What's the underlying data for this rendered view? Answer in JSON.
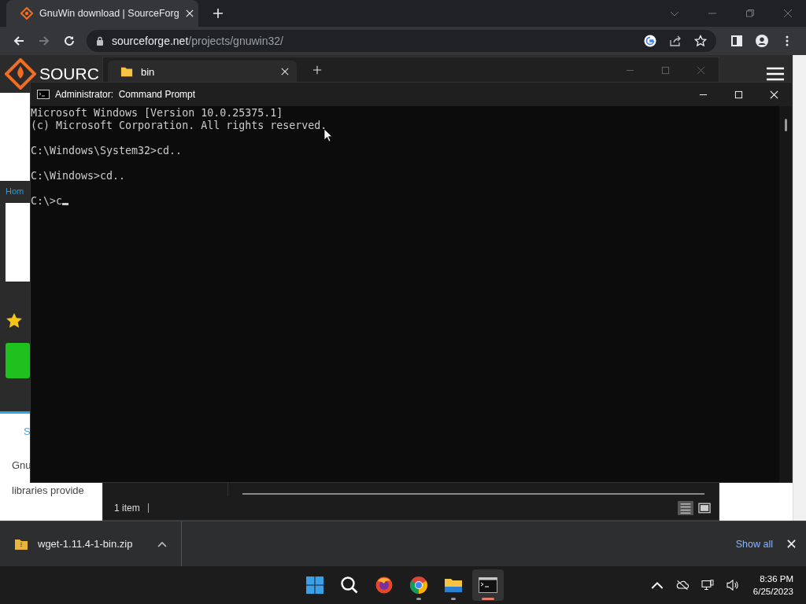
{
  "browser": {
    "tab": {
      "title": "GnuWin download | SourceForg"
    },
    "url": {
      "host": "sourceforge.net",
      "path": "/projects/gnuwin32/"
    }
  },
  "web_page": {
    "logo_text": "SOURC",
    "breadcrumb": "Hom",
    "section_tab": "S",
    "description": [
      "Gnu",
      "libraries provide"
    ]
  },
  "explorer": {
    "tab": "bin",
    "status": "1 item"
  },
  "cmd": {
    "title": "Administrator:  Command Prompt",
    "blocks": [
      {
        "lines": [
          "Microsoft Windows [Version 10.0.25375.1]",
          "(c) Microsoft Corporation. All rights reserved."
        ]
      },
      {
        "lines": [
          "C:\\Windows\\System32>cd.."
        ]
      },
      {
        "lines": [
          "C:\\Windows>cd.."
        ]
      },
      {
        "lines": [
          "C:\\>c"
        ]
      }
    ]
  },
  "downloads": {
    "items": [
      {
        "file": "wget-1.11.4-1-bin.zip"
      }
    ],
    "show_all": "Show all"
  },
  "taskbar": {
    "apps": [
      {
        "kind": "start",
        "running": false,
        "selected": false
      },
      {
        "kind": "search",
        "running": false,
        "selected": false
      },
      {
        "kind": "firefox",
        "running": false,
        "selected": false
      },
      {
        "kind": "chrome",
        "running": true,
        "selected": false
      },
      {
        "kind": "files",
        "running": true,
        "selected": false
      },
      {
        "kind": "terminal",
        "running": true,
        "selected": true
      }
    ],
    "time": "8:36 PM",
    "date": "6/25/2023"
  }
}
